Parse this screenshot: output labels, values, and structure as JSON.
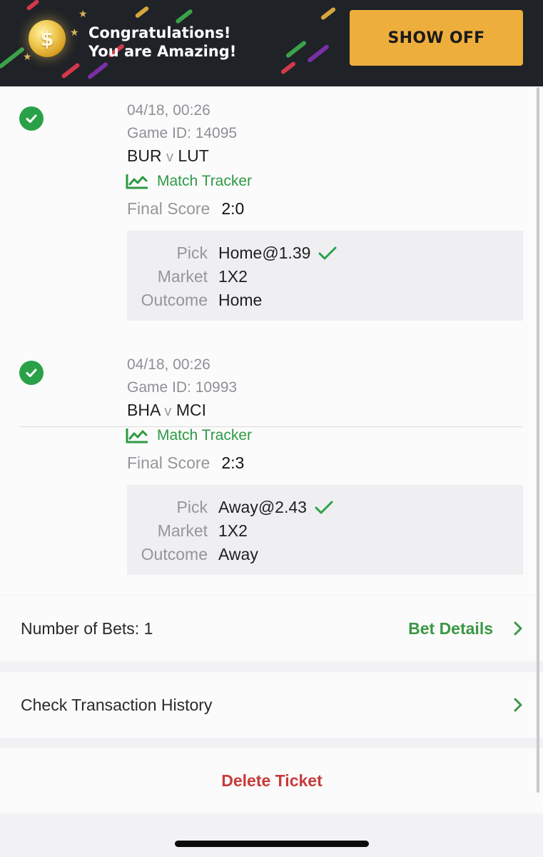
{
  "banner": {
    "title_line1": "Congratulations!",
    "title_line2": "You are Amazing!",
    "show_off_label": "SHOW OFF",
    "coin_symbol": "$",
    "colors": {
      "background": "#1f2227",
      "button": "#eeae3c"
    }
  },
  "bets": [
    {
      "datetime": "04/18, 00:26",
      "game_id": "Game ID: 14095",
      "home": "BUR",
      "vs": "v",
      "away": "LUT",
      "tracker_label": "Match Tracker",
      "score_label": "Final Score",
      "score": "2:0",
      "pick_label": "Pick",
      "pick": "Home@1.39",
      "market_label": "Market",
      "market": "1X2",
      "outcome_label": "Outcome",
      "outcome": "Home"
    },
    {
      "datetime": "04/18, 00:26",
      "game_id": "Game ID: 10993",
      "home": "BHA",
      "vs": "v",
      "away": "MCI",
      "tracker_label": "Match Tracker",
      "score_label": "Final Score",
      "score": "2:3",
      "pick_label": "Pick",
      "pick": "Away@2.43",
      "market_label": "Market",
      "market": "1X2",
      "outcome_label": "Outcome",
      "outcome": "Away"
    }
  ],
  "summary": {
    "number_of_bets": "Number of Bets: 1",
    "bet_details_label": "Bet Details"
  },
  "transaction": {
    "label": "Check Transaction History"
  },
  "delete": {
    "label": "Delete Ticket"
  },
  "icons": {
    "status": "check-circle-icon",
    "tracker": "chart-line-icon",
    "pick_won": "checkmark-icon",
    "row_arrow": "chevron-right-icon"
  },
  "colors": {
    "success_green": "#2aa148",
    "link_green": "#3a9845",
    "danger_red": "#c93a3a"
  }
}
